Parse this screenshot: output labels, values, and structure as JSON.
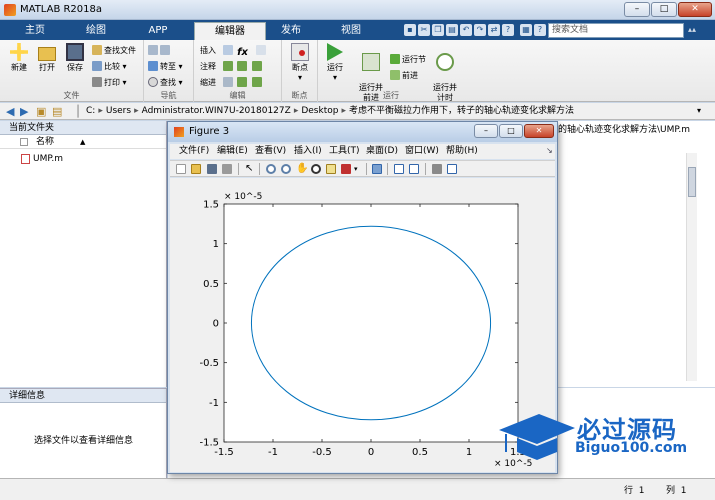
{
  "window": {
    "title": "MATLAB R2018a",
    "min": "–",
    "max": "□",
    "close": "✕"
  },
  "tabs": [
    {
      "label": "主页"
    },
    {
      "label": "绘图"
    },
    {
      "label": "APP"
    },
    {
      "label": "编辑器"
    },
    {
      "label": "发布"
    },
    {
      "label": "视图"
    }
  ],
  "search": {
    "placeholder": "搜索文档"
  },
  "toolstrip": {
    "file": {
      "label": "文件",
      "new": "新建",
      "open": "打开",
      "save": "保存",
      "find_files": "查找文件",
      "compare": "比较",
      "print": "打印"
    },
    "navigate": {
      "label": "导航",
      "goto": "转至",
      "find": "查找"
    },
    "edit": {
      "label": "编辑",
      "insert": "插入",
      "comment": "注释",
      "indent": "缩进"
    },
    "breakpoints": {
      "label": "断点",
      "btn": "断点"
    },
    "run": {
      "label": "运行",
      "run": "运行",
      "run_advance": "运行并\n前进",
      "run_section": "运行节",
      "advance": "前进",
      "run_time": "运行并\n计时"
    }
  },
  "address": {
    "crumbs": [
      "C:",
      "Users",
      "Administrator.WIN7U-20180127Z",
      "Desktop",
      "考虑不平衡磁拉力作用下，转子的轴心轨迹变化求解方法"
    ]
  },
  "current_folder": {
    "title": "当前文件夹",
    "column_name": "名称",
    "sort_indicator": "▲",
    "files": [
      {
        "name": "UMP.m"
      }
    ]
  },
  "details": {
    "title": "详细信息",
    "empty_text": "选择文件以查看详细信息"
  },
  "editor": {
    "tab_text": "的轴心轨迹变化求解方法\\UMP.m"
  },
  "status": {
    "ln_label": "行",
    "ln": "1",
    "col_label": "列",
    "col": "1"
  },
  "figure": {
    "title": "Figure 3",
    "menus": [
      "文件(F)",
      "编辑(E)",
      "查看(V)",
      "插入(I)",
      "工具(T)",
      "桌面(D)",
      "窗口(W)",
      "帮助(H)"
    ]
  },
  "chart_data": {
    "type": "line",
    "title": "",
    "xlabel": "",
    "ylabel": "",
    "xlim": [
      -1.5,
      1.5
    ],
    "ylim": [
      -1.5,
      1.5
    ],
    "x_multiplier": "× 10^-5",
    "y_multiplier": "× 10^-5",
    "xticks": [
      -1.5,
      -1,
      -0.5,
      0,
      0.5,
      1,
      1.5
    ],
    "yticks": [
      -1.5,
      -1,
      -0.5,
      0,
      0.5,
      1,
      1.5
    ],
    "xtick_labels": [
      "-1.5",
      "-1",
      "-0.5",
      "0",
      "0.5",
      "1",
      "1.5"
    ],
    "ytick_labels": [
      "-1.5",
      "-1",
      "-0.5",
      "0",
      "0.5",
      "1",
      "1.5"
    ],
    "grid": false,
    "series": [
      {
        "shape": "ellipse",
        "center": [
          0,
          0
        ],
        "x_radius": 1.22,
        "y_radius": 1.22,
        "color": "#0072bd"
      }
    ]
  },
  "watermark": {
    "title": "必过源码",
    "url": "Biguo100.com"
  },
  "colors": {
    "ribbon_blue": "#1b4f8a",
    "accent_blue": "#0072bd",
    "watermark_blue": "#1a66c4"
  }
}
